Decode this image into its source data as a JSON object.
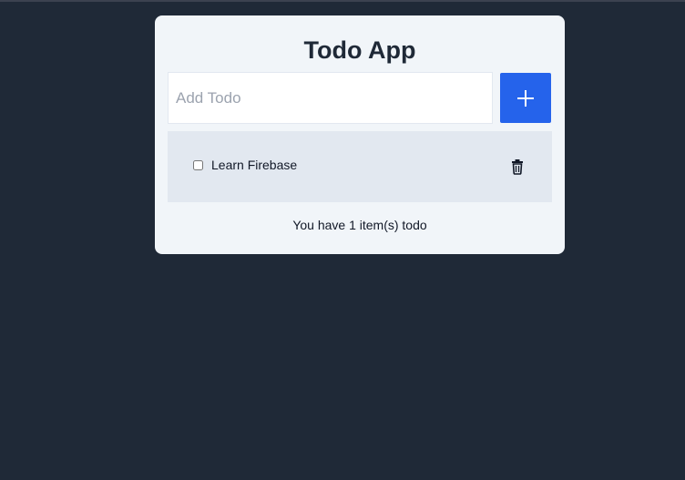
{
  "app": {
    "title": "Todo App"
  },
  "add_form": {
    "placeholder": "Add Todo",
    "value": "",
    "button_icon": "plus-icon"
  },
  "todos": [
    {
      "label": "Learn Firebase",
      "completed": false,
      "delete_icon": "trash-icon"
    }
  ],
  "footer": {
    "count_text": "You have 1 item(s) todo"
  },
  "colors": {
    "background": "#1f2937",
    "card": "#f1f5f9",
    "accent": "#2563eb",
    "list_item_bg": "#e2e8f0"
  }
}
